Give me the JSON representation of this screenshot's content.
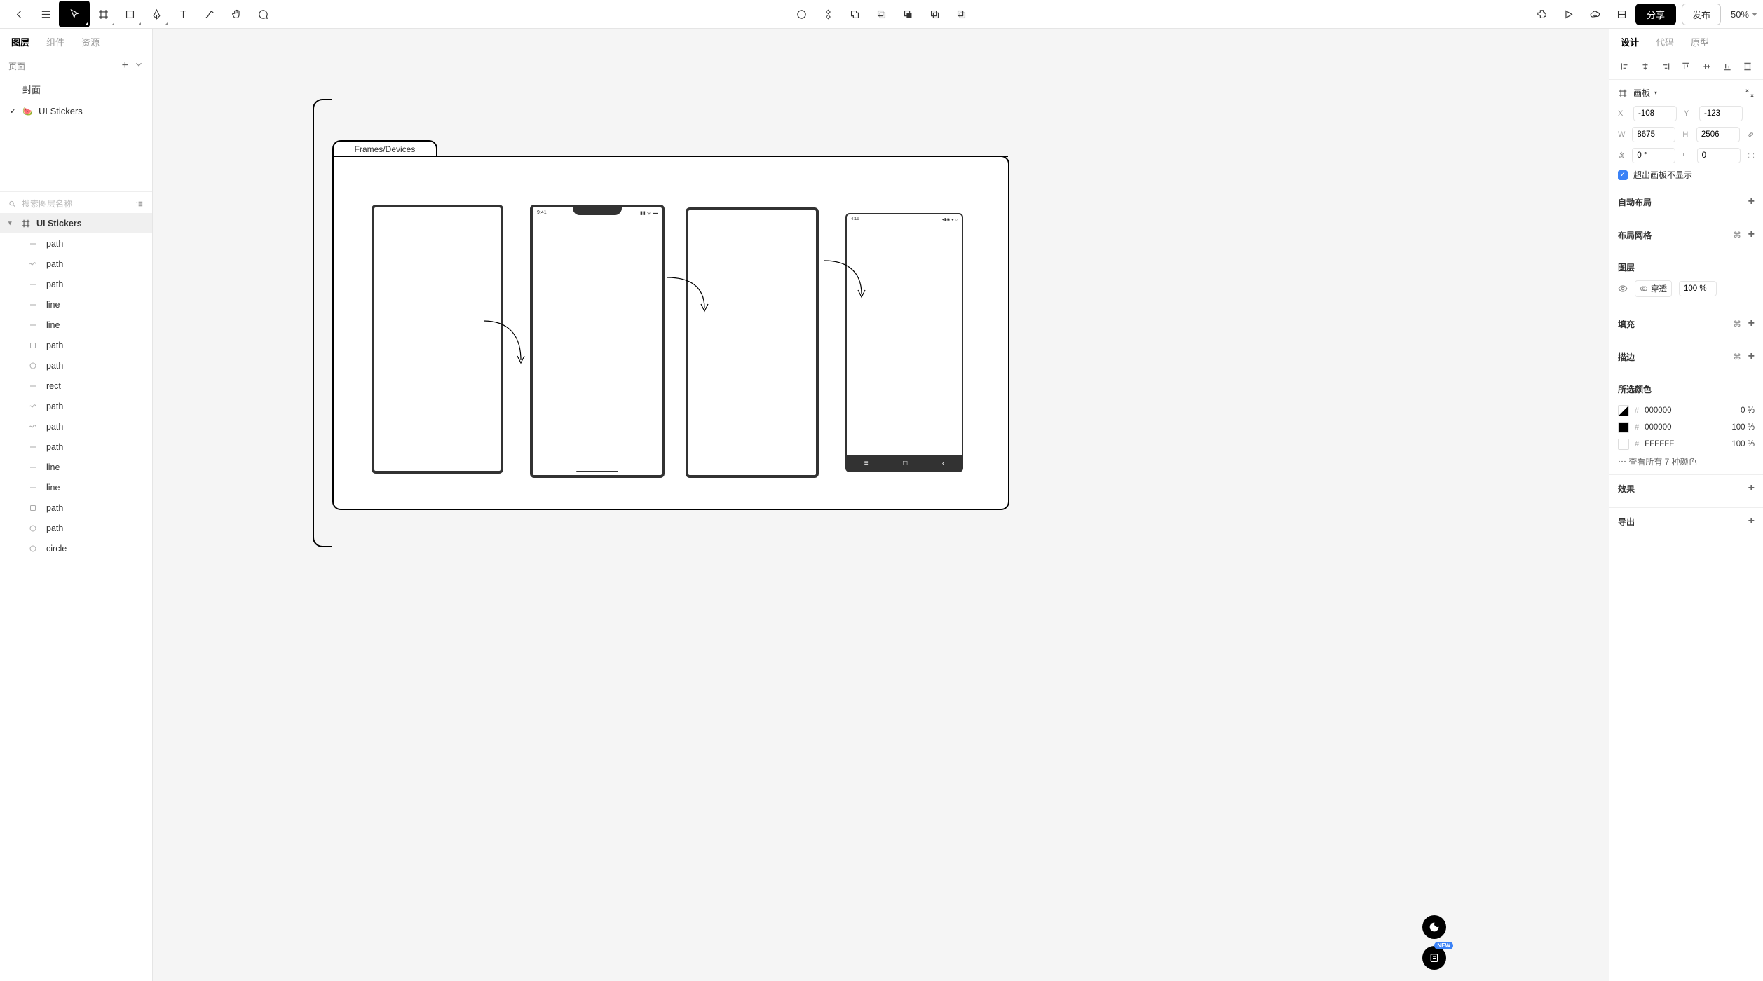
{
  "toolbar": {
    "share_label": "分享",
    "publish_label": "发布",
    "zoom": "50%"
  },
  "leftPanel": {
    "tabs": {
      "layers": "图层",
      "components": "组件",
      "assets": "资源"
    },
    "pages_label": "页面",
    "pages": [
      {
        "name": "封面",
        "checked": false,
        "emoji": ""
      },
      {
        "name": "UI Stickers",
        "checked": true,
        "emoji": "🍉"
      }
    ],
    "search_placeholder": "搜索图层名称",
    "root_frame": "UI Stickers",
    "layers": [
      {
        "type": "line",
        "name": "path"
      },
      {
        "type": "wave",
        "name": "path"
      },
      {
        "type": "line",
        "name": "path"
      },
      {
        "type": "line",
        "name": "line"
      },
      {
        "type": "line",
        "name": "line"
      },
      {
        "type": "rect",
        "name": "path"
      },
      {
        "type": "circle",
        "name": "path"
      },
      {
        "type": "line",
        "name": "rect"
      },
      {
        "type": "wave",
        "name": "path"
      },
      {
        "type": "wave",
        "name": "path"
      },
      {
        "type": "line",
        "name": "path"
      },
      {
        "type": "line",
        "name": "line"
      },
      {
        "type": "line",
        "name": "line"
      },
      {
        "type": "rect",
        "name": "path"
      },
      {
        "type": "circle",
        "name": "path"
      },
      {
        "type": "circle",
        "name": "circle"
      }
    ]
  },
  "canvas": {
    "folder_label": "Frames/Devices",
    "iphone_time": "9:41",
    "android_time": "4:19"
  },
  "rightPanel": {
    "tabs": {
      "design": "设计",
      "code": "代码",
      "prototype": "原型"
    },
    "frame_label": "画板",
    "x": "-108",
    "y": "-123",
    "w": "8675",
    "h": "2506",
    "rotation": "0 °",
    "radius": "0",
    "clip_label": "超出画板不显示",
    "autolayout_label": "自动布局",
    "grid_label": "布局网格",
    "layer_section": "图层",
    "blend_mode": "穿透",
    "opacity": "100 %",
    "fill_label": "填充",
    "stroke_label": "描边",
    "colors_label": "所选颜色",
    "colors": [
      {
        "swatch": "tri",
        "hex": "000000",
        "pct": "0 %"
      },
      {
        "swatch": "#000000",
        "hex": "000000",
        "pct": "100 %"
      },
      {
        "swatch": "#FFFFFF",
        "hex": "FFFFFF",
        "pct": "100 %"
      }
    ],
    "see_all_colors": "查看所有 7 种颜色",
    "effects_label": "效果",
    "export_label": "导出",
    "new_badge": "NEW"
  }
}
